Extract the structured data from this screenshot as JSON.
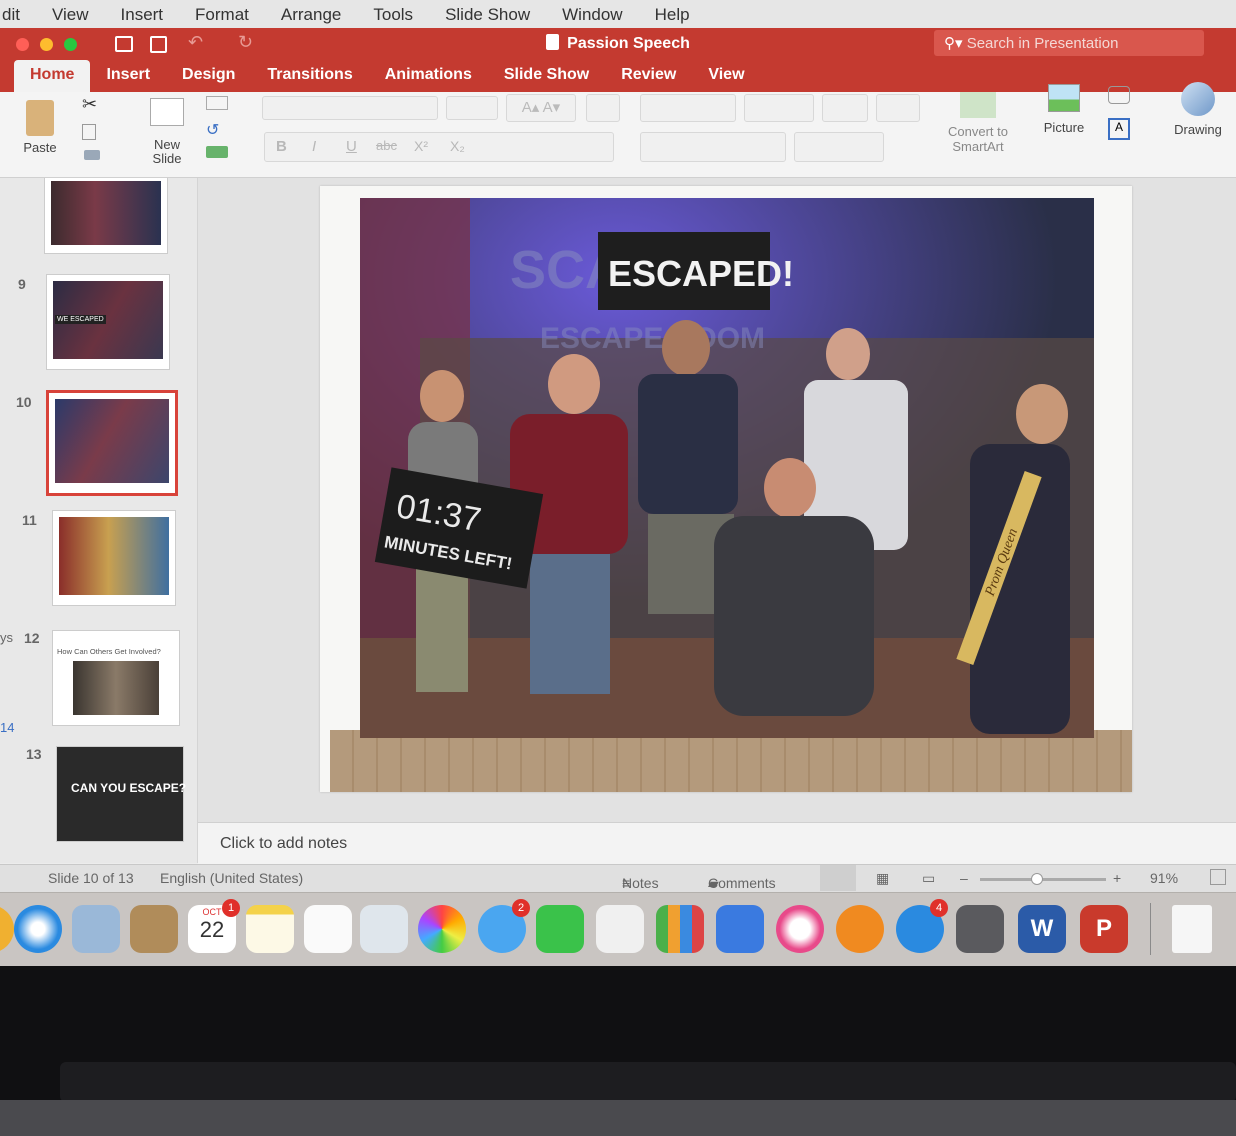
{
  "menubar": {
    "items": [
      "dit",
      "View",
      "Insert",
      "Format",
      "Arrange",
      "Tools",
      "Slide Show",
      "Window",
      "Help"
    ]
  },
  "window": {
    "title": "Passion Speech",
    "search_placeholder": "Search in Presentation",
    "accent": "#c43a30"
  },
  "ribbon": {
    "tabs": [
      "Home",
      "Insert",
      "Design",
      "Transitions",
      "Animations",
      "Slide Show",
      "Review",
      "View"
    ],
    "active_tab": "Home",
    "paste_label": "Paste",
    "new_slide_label_1": "New",
    "new_slide_label_2": "Slide",
    "convert_label_1": "Convert to",
    "convert_label_2": "SmartArt",
    "picture_label": "Picture",
    "drawing_label": "Drawing",
    "font_buttons": [
      "B",
      "I",
      "U",
      "abc",
      "X²",
      "X₂"
    ]
  },
  "thumbnails": [
    {
      "number": "",
      "caption": ""
    },
    {
      "number": "9",
      "caption": "WE ESCAPED"
    },
    {
      "number": "10",
      "caption": "",
      "selected": true
    },
    {
      "number": "11",
      "caption": ""
    },
    {
      "number": "12",
      "caption": "How Can Others Get Involved?"
    },
    {
      "number": "13",
      "caption": "CAN YOU ESCAPE?"
    }
  ],
  "left_edge_labels": [
    "ys",
    "14"
  ],
  "slide": {
    "sign_escaped": "ESCAPED!",
    "sign_time": "01:37",
    "sign_minutes": "MINUTES LEFT!",
    "background_text_1": "SCAPE",
    "background_text_2": "ESCAPE ROOM",
    "sash_text": "Prom Queen"
  },
  "notes": {
    "placeholder": "Click to add notes"
  },
  "status": {
    "slide_counter": "Slide 10 of 13",
    "language": "English (United States)",
    "notes_label": "Notes",
    "comments_label": "Comments",
    "zoom_minus": "–",
    "zoom_plus": "+",
    "zoom_level": "91%",
    "zoom_fraction": 0.45
  },
  "dock": {
    "calendar_month": "OCT",
    "calendar_day": "22",
    "calendar_badge": "1",
    "messages_badge": "2",
    "appstore_badge": "4",
    "word_letter": "W",
    "powerpoint_letter": "P"
  }
}
